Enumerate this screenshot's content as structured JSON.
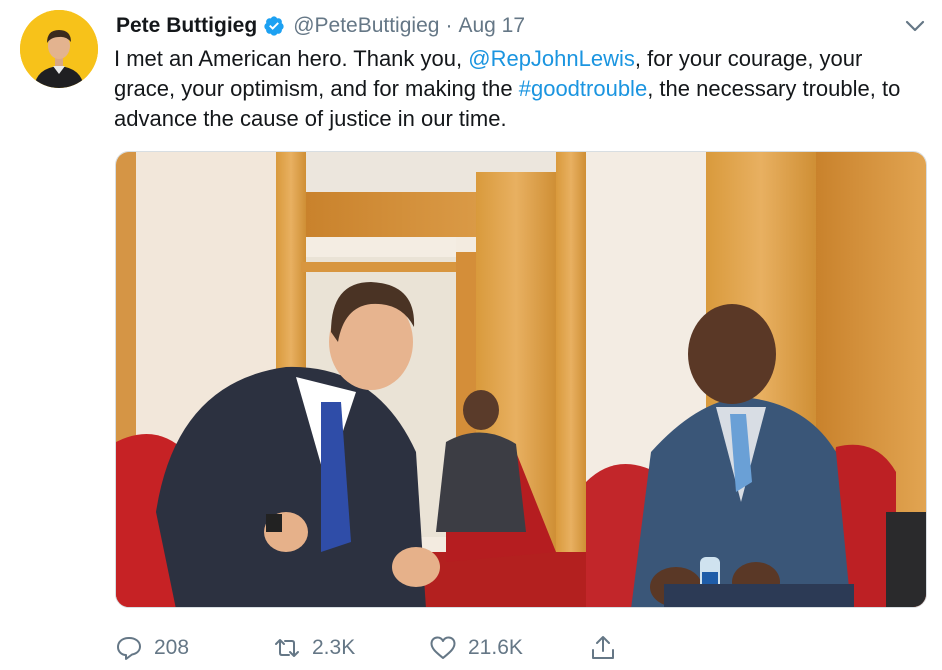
{
  "tweet": {
    "author_name": "Pete Buttigieg",
    "handle": "@PeteButtigieg",
    "separator": "·",
    "date": "Aug 17",
    "text_parts": {
      "p1": "I met an American hero. Thank you, ",
      "mention": "@RepJohnLewis",
      "p2": ", for your courage, your grace, your optimism, and for making the ",
      "hashtag": "#goodtrouble",
      "p3": ", the necessary trouble, to advance the cause of justice in our time."
    }
  },
  "actions": {
    "replies": "208",
    "retweets": "2.3K",
    "likes": "21.6K"
  },
  "icons": {
    "verified": "verified-badge-icon",
    "chevron": "chevron-down-icon",
    "reply": "reply-icon",
    "retweet": "retweet-icon",
    "like": "heart-icon",
    "share": "share-icon"
  },
  "colors": {
    "link": "#1b95e0",
    "verified": "#1da1f2",
    "secondary_text": "#657786",
    "avatar_bg": "#f7c21a"
  }
}
